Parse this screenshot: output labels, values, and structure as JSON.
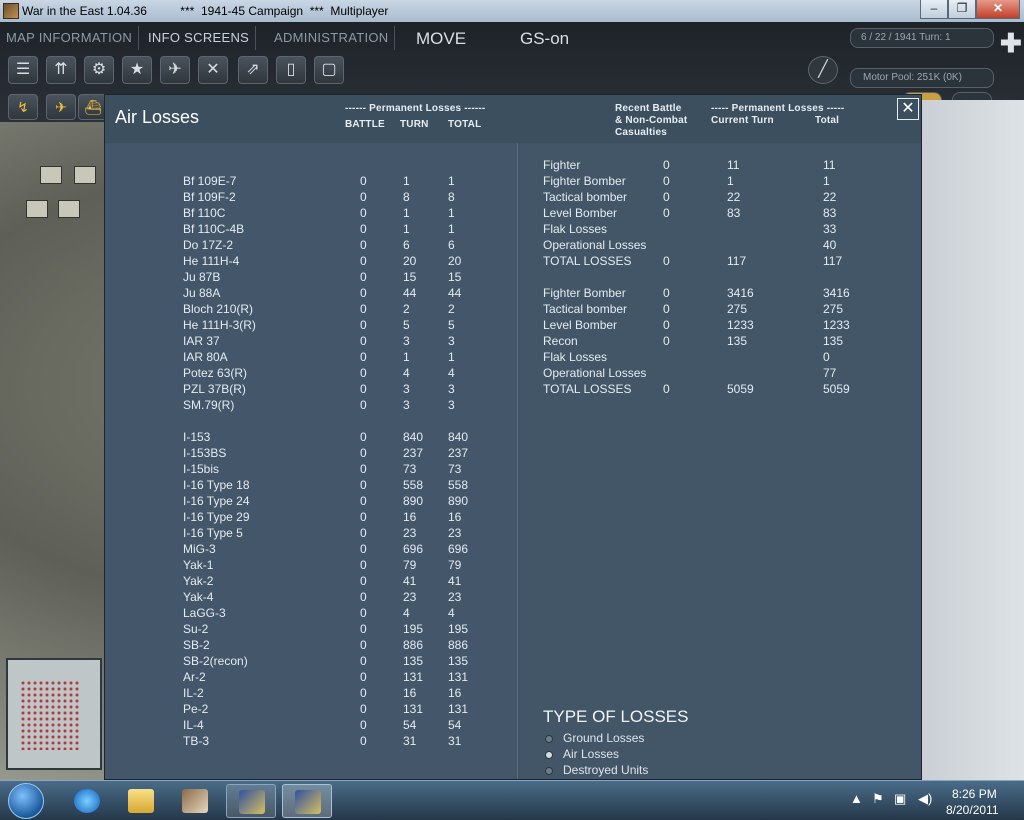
{
  "window": {
    "title": "War in the East 1.04.36          ***  1941-45 Campaign  ***  Multiplayer",
    "min": "–",
    "max": "❐",
    "close": "✕"
  },
  "menu": {
    "map_information": "MAP INFORMATION",
    "info_screens": "INFO SCREENS",
    "administration": "ADMINISTRATION",
    "move": "MOVE",
    "gs": "GS-on",
    "date_turn": "6 / 22 / 1941  Turn: 1",
    "motor_pool": "Motor Pool:  251K (0K)"
  },
  "panel": {
    "title": "Air Losses",
    "close_label": "✕",
    "left_headers": {
      "group": "------ Permanent Losses ------",
      "battle": "BATTLE",
      "turn": "TURN",
      "total": "TOTAL"
    },
    "right_headers": {
      "recent_1": "Recent Battle",
      "recent_2": "& Non-Combat",
      "recent_3": "Casualties",
      "group": "----- Permanent Losses -----",
      "current_turn": "Current Turn",
      "total": "Total"
    },
    "axis_aircraft": [
      {
        "name": "Bf 109E-7",
        "battle": "0",
        "turn": "1",
        "total": "1"
      },
      {
        "name": "Bf 109F-2",
        "battle": "0",
        "turn": "8",
        "total": "8"
      },
      {
        "name": "Bf 110C",
        "battle": "0",
        "turn": "1",
        "total": "1"
      },
      {
        "name": "Bf 110C-4B",
        "battle": "0",
        "turn": "1",
        "total": "1"
      },
      {
        "name": "Do 17Z-2",
        "battle": "0",
        "turn": "6",
        "total": "6"
      },
      {
        "name": "He 111H-4",
        "battle": "0",
        "turn": "20",
        "total": "20"
      },
      {
        "name": "Ju 87B",
        "battle": "0",
        "turn": "15",
        "total": "15"
      },
      {
        "name": "Ju 88A",
        "battle": "0",
        "turn": "44",
        "total": "44"
      },
      {
        "name": "Bloch 210(R)",
        "battle": "0",
        "turn": "2",
        "total": "2"
      },
      {
        "name": "He 111H-3(R)",
        "battle": "0",
        "turn": "5",
        "total": "5"
      },
      {
        "name": "IAR 37",
        "battle": "0",
        "turn": "3",
        "total": "3"
      },
      {
        "name": "IAR 80A",
        "battle": "0",
        "turn": "1",
        "total": "1"
      },
      {
        "name": "Potez 63(R)",
        "battle": "0",
        "turn": "4",
        "total": "4"
      },
      {
        "name": "PZL 37B(R)",
        "battle": "0",
        "turn": "3",
        "total": "3"
      },
      {
        "name": "SM.79(R)",
        "battle": "0",
        "turn": "3",
        "total": "3"
      }
    ],
    "soviet_aircraft": [
      {
        "name": "I-153",
        "battle": "0",
        "turn": "840",
        "total": "840"
      },
      {
        "name": "I-153BS",
        "battle": "0",
        "turn": "237",
        "total": "237"
      },
      {
        "name": "I-15bis",
        "battle": "0",
        "turn": "73",
        "total": "73"
      },
      {
        "name": "I-16 Type 18",
        "battle": "0",
        "turn": "558",
        "total": "558"
      },
      {
        "name": "I-16 Type 24",
        "battle": "0",
        "turn": "890",
        "total": "890"
      },
      {
        "name": "I-16 Type 29",
        "battle": "0",
        "turn": "16",
        "total": "16"
      },
      {
        "name": "I-16 Type 5",
        "battle": "0",
        "turn": "23",
        "total": "23"
      },
      {
        "name": "MiG-3",
        "battle": "0",
        "turn": "696",
        "total": "696"
      },
      {
        "name": "Yak-1",
        "battle": "0",
        "turn": "79",
        "total": "79"
      },
      {
        "name": "Yak-2",
        "battle": "0",
        "turn": "41",
        "total": "41"
      },
      {
        "name": "Yak-4",
        "battle": "0",
        "turn": "23",
        "total": "23"
      },
      {
        "name": "LaGG-3",
        "battle": "0",
        "turn": "4",
        "total": "4"
      },
      {
        "name": "Su-2",
        "battle": "0",
        "turn": "195",
        "total": "195"
      },
      {
        "name": "SB-2",
        "battle": "0",
        "turn": "886",
        "total": "886"
      },
      {
        "name": "SB-2(recon)",
        "battle": "0",
        "turn": "135",
        "total": "135"
      },
      {
        "name": "Ar-2",
        "battle": "0",
        "turn": "131",
        "total": "131"
      },
      {
        "name": "IL-2",
        "battle": "0",
        "turn": "16",
        "total": "16"
      },
      {
        "name": "Pe-2",
        "battle": "0",
        "turn": "131",
        "total": "131"
      },
      {
        "name": "IL-4",
        "battle": "0",
        "turn": "54",
        "total": "54"
      },
      {
        "name": "TB-3",
        "battle": "0",
        "turn": "31",
        "total": "31"
      }
    ],
    "axis_summary": [
      {
        "type": "Fighter",
        "recent": "0",
        "current": "11",
        "total": "11"
      },
      {
        "type": "Fighter Bomber",
        "recent": "0",
        "current": "1",
        "total": "1"
      },
      {
        "type": "Tactical bomber",
        "recent": "0",
        "current": "22",
        "total": "22"
      },
      {
        "type": "Level Bomber",
        "recent": "0",
        "current": "83",
        "total": "83"
      },
      {
        "type": "Flak Losses",
        "recent": "",
        "current": "",
        "total": "33"
      },
      {
        "type": "Operational Losses",
        "recent": "",
        "current": "",
        "total": "40"
      },
      {
        "type": "TOTAL LOSSES",
        "recent": "0",
        "current": "117",
        "total": "117"
      }
    ],
    "soviet_summary": [
      {
        "type": "Fighter Bomber",
        "recent": "0",
        "current": "3416",
        "total": "3416"
      },
      {
        "type": "Tactical bomber",
        "recent": "0",
        "current": "275",
        "total": "275"
      },
      {
        "type": "Level Bomber",
        "recent": "0",
        "current": "1233",
        "total": "1233"
      },
      {
        "type": "Recon",
        "recent": "0",
        "current": "135",
        "total": "135"
      },
      {
        "type": "Flak Losses",
        "recent": "",
        "current": "",
        "total": "0"
      },
      {
        "type": "Operational Losses",
        "recent": "",
        "current": "",
        "total": "77"
      },
      {
        "type": "TOTAL LOSSES",
        "recent": "0",
        "current": "5059",
        "total": "5059"
      }
    ],
    "types_title": "TYPE OF LOSSES",
    "types": [
      {
        "label": "Ground Losses",
        "selected": false
      },
      {
        "label": "Air Losses",
        "selected": true
      },
      {
        "label": "Destroyed Units",
        "selected": false
      }
    ]
  },
  "taskbar": {
    "time": "8:26 PM",
    "date": "8/20/2011",
    "icons": [
      "start-orb-icon",
      "internet-explorer-icon",
      "folder-icon",
      "photo-icon",
      "game-icon",
      "game-icon"
    ]
  },
  "colors": {
    "panel_bg": "#3f5262",
    "panel_text": "#e6ebef",
    "taskbar": "#25384a"
  }
}
